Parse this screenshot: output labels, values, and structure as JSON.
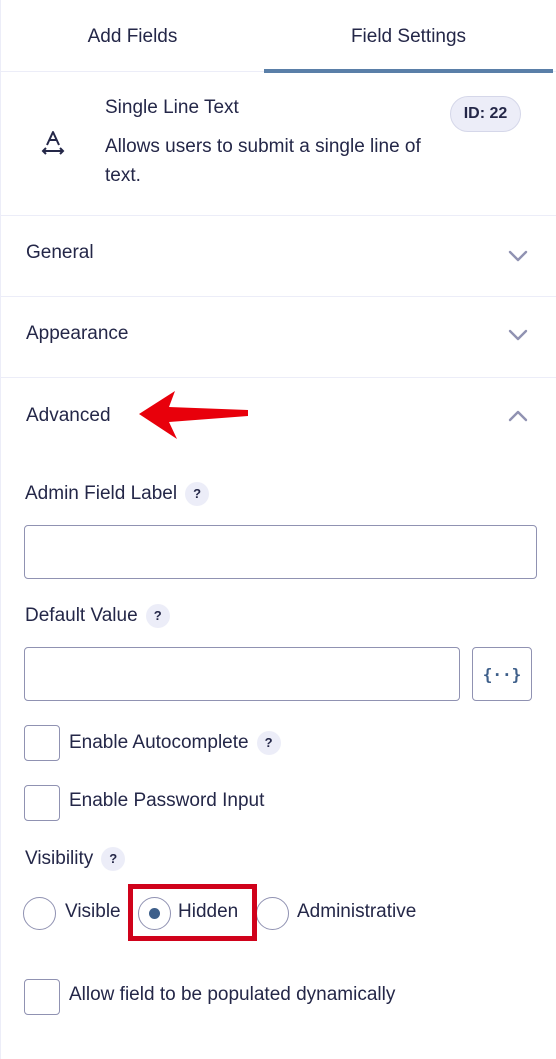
{
  "tabs": [
    {
      "label": "Add Fields",
      "active": false
    },
    {
      "label": "Field Settings",
      "active": true
    }
  ],
  "field": {
    "icon": "text-field-icon",
    "title": "Single Line Text",
    "description": "Allows users to submit a single line of text.",
    "id_badge": "ID: 22"
  },
  "sections": {
    "general": {
      "label": "General",
      "expanded": false
    },
    "appearance": {
      "label": "Appearance",
      "expanded": false
    },
    "advanced": {
      "label": "Advanced",
      "expanded": true
    }
  },
  "advanced": {
    "admin_field_label": {
      "label": "Admin Field Label",
      "help": "?",
      "value": "",
      "placeholder": ""
    },
    "default_value": {
      "label": "Default Value",
      "help": "?",
      "value": "",
      "placeholder": "",
      "merge_tag_icon": "merge-tag-icon",
      "merge_tag_glyph": "{··}"
    },
    "enable_autocomplete": {
      "label": "Enable Autocomplete",
      "help": "?",
      "checked": false
    },
    "enable_password_input": {
      "label": "Enable Password Input",
      "checked": false
    },
    "visibility": {
      "label": "Visibility",
      "help": "?",
      "options": [
        "Visible",
        "Hidden",
        "Administrative"
      ],
      "selected": "Hidden"
    },
    "allow_dynamic_population": {
      "label": "Allow field to be populated dynamically",
      "checked": false
    }
  },
  "annotation": {
    "arrow_color": "#e8000b",
    "highlight_color": "#d0021b"
  },
  "colors": {
    "accent": "#5a7fa8",
    "text": "#242748",
    "border": "#9092b2",
    "badge_bg": "#ecedf8"
  }
}
